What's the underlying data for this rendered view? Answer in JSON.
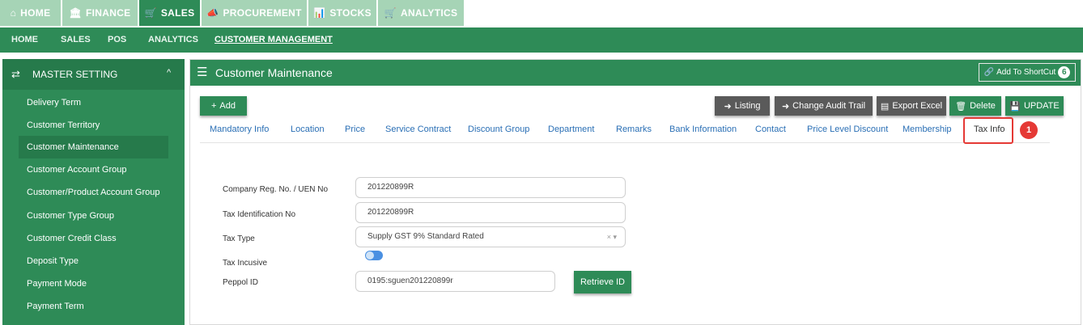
{
  "modules": [
    {
      "label": "HOME",
      "icon": "home-icon",
      "glyph": "⌂",
      "active": false
    },
    {
      "label": "FINANCE",
      "icon": "bank-icon",
      "glyph": "🏛",
      "active": false
    },
    {
      "label": "SALES",
      "icon": "cart-icon",
      "glyph": "🛒",
      "active": true
    },
    {
      "label": "PROCUREMENT",
      "icon": "megaphone-icon",
      "glyph": "📣",
      "active": false
    },
    {
      "label": "STOCKS",
      "icon": "chart-icon",
      "glyph": "📊",
      "active": false
    },
    {
      "label": "ANALYTICS",
      "icon": "cart-icon",
      "glyph": "🛒",
      "active": false
    }
  ],
  "subnav": [
    {
      "label": "HOME"
    },
    {
      "label": "SALES"
    },
    {
      "label": "POS"
    },
    {
      "label": "ANALYTICS"
    },
    {
      "label": "CUSTOMER MANAGEMENT",
      "active": true
    }
  ],
  "sidebar": {
    "header": "MASTER SETTING",
    "items": [
      {
        "label": "Delivery Term"
      },
      {
        "label": "Customer Territory"
      },
      {
        "label": "Customer Maintenance",
        "active": true
      },
      {
        "label": "Customer Account Group"
      },
      {
        "label": "Customer/Product Account Group"
      },
      {
        "label": "Customer Type Group"
      },
      {
        "label": "Customer Credit Class"
      },
      {
        "label": "Deposit Type"
      },
      {
        "label": "Payment Mode"
      },
      {
        "label": "Payment Term"
      }
    ]
  },
  "main": {
    "title": "Customer Maintenance",
    "shortcut_label": "Add To ShortCut",
    "shortcut_count": "6",
    "add_label": "Add",
    "actions": {
      "listing": "Listing",
      "audit": "Change Audit Trail",
      "export": "Export Excel",
      "delete": "Delete",
      "update": "UPDATE"
    },
    "tabs": [
      {
        "label": "Mandatory Info"
      },
      {
        "label": "Location"
      },
      {
        "label": "Price"
      },
      {
        "label": "Service Contract"
      },
      {
        "label": "Discount Group"
      },
      {
        "label": "Department"
      },
      {
        "label": "Remarks"
      },
      {
        "label": "Bank Information"
      },
      {
        "label": "Contact"
      },
      {
        "label": "Price Level Discount"
      },
      {
        "label": "Membership"
      },
      {
        "label": "Tax Info",
        "active": true
      }
    ],
    "callout_number": "1"
  },
  "form": {
    "company_reg_label": "Company Reg. No. / UEN No",
    "company_reg_value": "201220899R",
    "tax_id_label": "Tax Identification No",
    "tax_id_value": "201220899R",
    "tax_type_label": "Tax Type",
    "tax_type_value": "Supply GST 9% Standard Rated",
    "tax_inclusive_label": "Tax Incusive",
    "tax_inclusive_on": true,
    "peppol_label": "Peppol ID",
    "peppol_value": "0195:sguen201220899r",
    "retrieve_label": "Retrieve ID"
  }
}
